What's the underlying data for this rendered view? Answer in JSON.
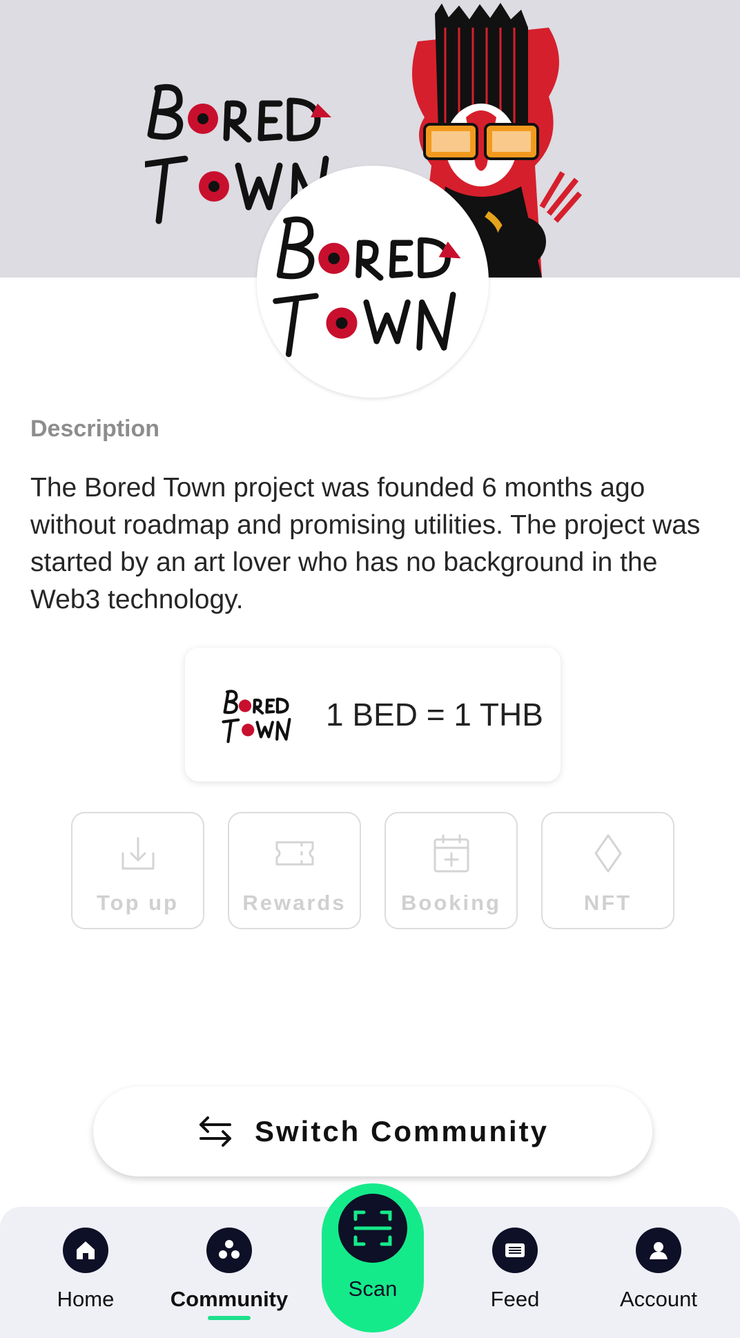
{
  "banner": {
    "logo_alt": "Bored Town",
    "avatar_alt": "Bored Town"
  },
  "description": {
    "label": "Description",
    "text": "The Bored Town project was founded 6 months ago without roadmap and promising utilities. The project was started by an art lover who has no background in the Web3 technology."
  },
  "rate": {
    "text": "1 BED = 1 THB"
  },
  "actions": [
    {
      "label": "Top up",
      "icon": "download-icon"
    },
    {
      "label": "Rewards",
      "icon": "ticket-icon"
    },
    {
      "label": "Booking",
      "icon": "calendar-plus-icon"
    },
    {
      "label": "NFT",
      "icon": "diamond-icon"
    }
  ],
  "switch_button": {
    "label": "Switch Community",
    "icon": "swap-arrows-icon"
  },
  "nav": {
    "items": [
      {
        "label": "Home",
        "icon": "home-icon"
      },
      {
        "label": "Community",
        "icon": "community-icon",
        "active": true
      },
      {
        "label": "Scan",
        "icon": "scan-icon"
      },
      {
        "label": "Feed",
        "icon": "feed-icon"
      },
      {
        "label": "Account",
        "icon": "account-icon"
      }
    ]
  },
  "colors": {
    "accent": "#15ea8a",
    "nav_icon_bg": "#0d1026",
    "banner_bg": "#dcdce2",
    "logo_red": "#c8102e"
  }
}
